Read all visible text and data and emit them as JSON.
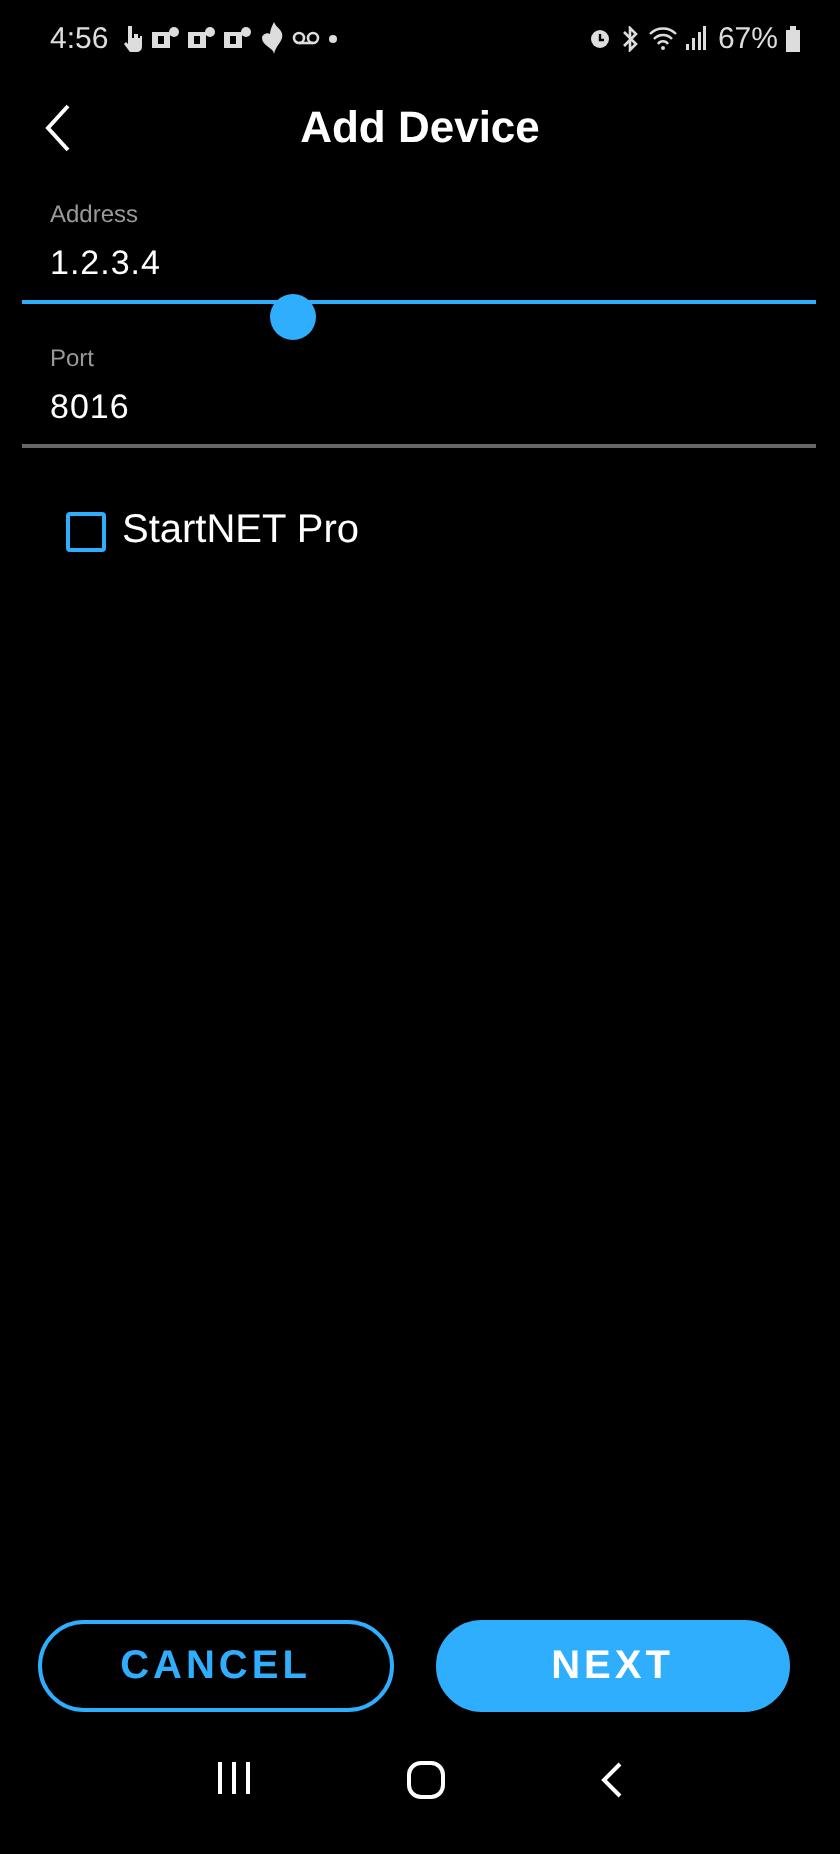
{
  "status_bar": {
    "time": "4:56",
    "battery_text": "67%"
  },
  "header": {
    "title": "Add Device"
  },
  "fields": [
    {
      "label": "Address",
      "value": "1.2.3.4",
      "focused": true
    },
    {
      "label": "Port",
      "value": "8016",
      "focused": false
    }
  ],
  "checkbox": {
    "label": "StartNET Pro",
    "checked": false
  },
  "buttons": [
    {
      "label": "CANCEL",
      "kind": "outline"
    },
    {
      "label": "NEXT",
      "kind": "filled"
    }
  ]
}
